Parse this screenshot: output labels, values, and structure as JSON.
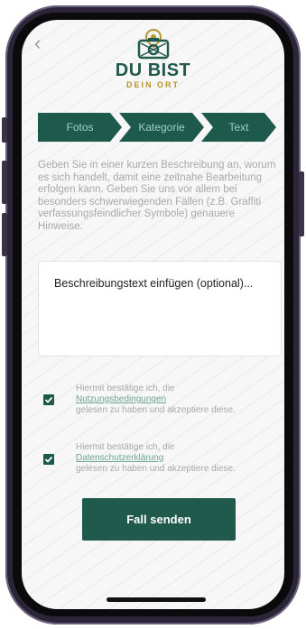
{
  "logo": {
    "title": "DU BIST",
    "subtitle": "DEIN ORT"
  },
  "steps": [
    "Fotos",
    "Kategorie",
    "Text"
  ],
  "description": "Geben Sie in einer kurzen Beschreibung an, worum es sich handelt, damit eine zeitnahe Bearbeitung erfolgen kann. Geben Sie uns vor allem bei besonders schwerwiegenden Fällen (z.B. Graffiti verfassungsfeindlicher Symbole) genauere Hinweise.",
  "textbox": {
    "placeholder": "Beschreibungstext einfügen (optional)..."
  },
  "consents": [
    {
      "prefix": "Hiermit bestätige ich, die",
      "link": "Nutzungsbedingungen",
      "suffix": "gelesen zu haben und akzeptiere diese.",
      "checked": true
    },
    {
      "prefix": "Hiermit bestätige ich, die",
      "link": "Datenschutzerklärung",
      "suffix": "gelesen zu haben und akzeptiere diese.",
      "checked": true
    }
  ],
  "submit_label": "Fall senden",
  "colors": {
    "primary": "#1e5a4c",
    "step_text": "#9fd1c2",
    "accent_gold": "#b8922b",
    "muted_text": "#a9a9a9",
    "link": "#6ea597"
  }
}
